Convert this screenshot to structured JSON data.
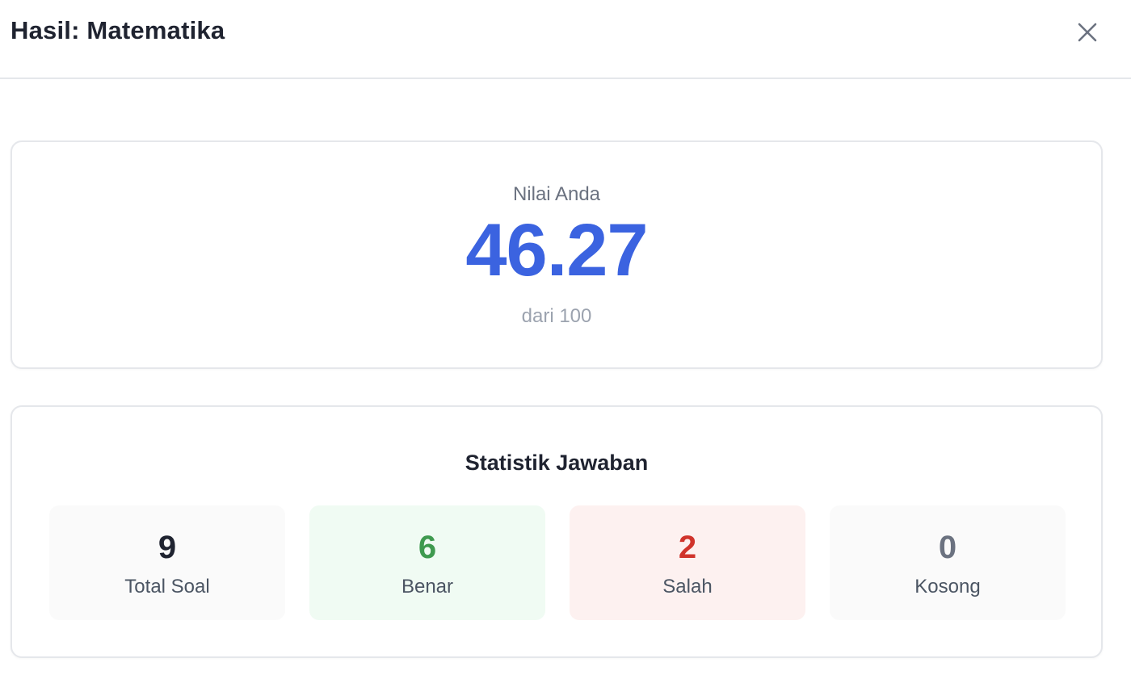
{
  "header": {
    "title": "Hasil: Matematika",
    "close_icon": "close-icon"
  },
  "score": {
    "label": "Nilai Anda",
    "value": "46.27",
    "max_text": "dari 100",
    "color": "#3b63e0"
  },
  "stats": {
    "title": "Statistik Jawaban",
    "items": [
      {
        "value": "9",
        "label": "Total Soal",
        "color": "#1f2330",
        "background": "#fafafa"
      },
      {
        "value": "6",
        "label": "Benar",
        "color": "#3f9a4f",
        "background": "#f0fbf3"
      },
      {
        "value": "2",
        "label": "Salah",
        "color": "#d0342c",
        "background": "#fdf1f0"
      },
      {
        "value": "0",
        "label": "Kosong",
        "color": "#6b7280",
        "background": "#fafafa"
      }
    ]
  }
}
